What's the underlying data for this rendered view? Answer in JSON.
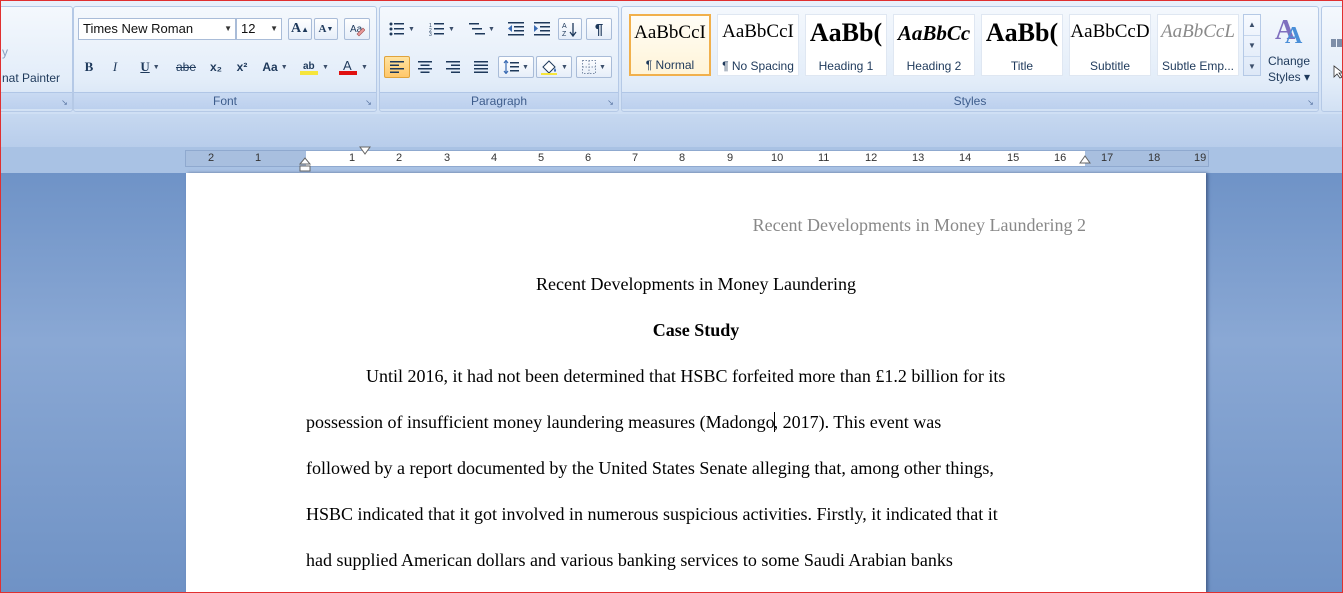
{
  "ribbon": {
    "clipboard": {
      "format_painter": "nat Painter"
    },
    "font": {
      "group_label": "Font",
      "font_name": "Times New Roman",
      "font_size": "12",
      "grow_font": "A",
      "shrink_font": "A",
      "bold": "B",
      "italic": "I",
      "underline": "U",
      "strikethrough": "abe",
      "subscript": "x₂",
      "superscript": "x²",
      "change_case": "Aa",
      "font_color": "A",
      "highlight_color": "#f6e53c",
      "font_color_value": "#e01010"
    },
    "paragraph": {
      "group_label": "Paragraph",
      "show_marks": "¶"
    },
    "styles": {
      "group_label": "Styles",
      "items": [
        {
          "preview": "AaBbCcI",
          "name": "¶ Normal"
        },
        {
          "preview": "AaBbCcI",
          "name": "¶ No Spacing"
        },
        {
          "preview": "AaBb(",
          "name": "Heading 1"
        },
        {
          "preview": "AaBbCc",
          "name": "Heading 2"
        },
        {
          "preview": "AaBb(",
          "name": "Title"
        },
        {
          "preview": "AaBbCcD",
          "name": "Subtitle"
        },
        {
          "preview": "AaBbCcL",
          "name": "Subtle Emp..."
        }
      ],
      "change_styles_line1": "Change",
      "change_styles_line2": "Styles ▾"
    }
  },
  "ruler": {
    "left_labels": [
      "2",
      "1"
    ],
    "right_labels": [
      "1",
      "2",
      "3",
      "4",
      "5",
      "6",
      "7",
      "8",
      "9",
      "10",
      "11",
      "12",
      "13",
      "14",
      "15",
      "16",
      "17",
      "18",
      "19"
    ]
  },
  "document": {
    "running_head": "Recent Developments in Money Laundering 2",
    "title": "Recent Developments in Money Laundering",
    "section_heading": "Case Study",
    "lines": [
      "Until 2016, it had not been determined that HSBC forfeited more than £1.2 billion for its",
      "possession of insufficient money laundering measures (Madongo",
      ", 2017). This event was",
      "followed by a report documented by the United States Senate alleging that, among other things,",
      "HSBC indicated that it got involved in numerous suspicious activities. Firstly, it indicated that it",
      "had supplied American dollars and various banking services to some Saudi Arabian banks"
    ]
  }
}
